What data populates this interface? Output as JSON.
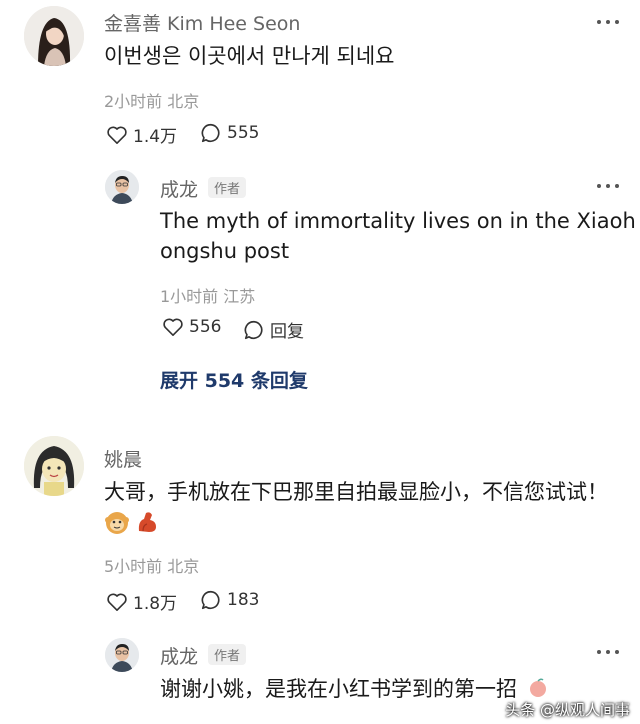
{
  "comments": [
    {
      "author": "金喜善 Kim Hee Seon",
      "text": "이번생은 이곳에서 만나게 되네요",
      "meta": "2小时前 北京",
      "likes": "1.4万",
      "replies": "555",
      "avatar_icon": "woman-portrait-avatar"
    },
    {
      "author": "姚晨",
      "text": "大哥，手机放在下巴那里自拍最显脸小，不信您试试！",
      "meta": "5小时前 北京",
      "likes": "1.8万",
      "replies": "183",
      "avatar_icon": "cartoon-girl-avatar"
    }
  ],
  "replies": [
    {
      "author": "成龙",
      "badge": "作者",
      "text_line1": "The myth of immortality lives on in the Xiaoh",
      "text_line2": "ongshu post",
      "meta": "1小时前 江苏",
      "likes": "556",
      "reply_label": "回复"
    },
    {
      "author": "成龙",
      "badge": "作者",
      "text": "谢谢小姚，是我在小红书学到的第一招"
    }
  ],
  "expand_label": "展开 554 条回复",
  "watermark": "头条 @纵观人间事",
  "icons": [
    "heart-icon",
    "comment-bubble-icon",
    "more-dots-icon",
    "monkey-emoji-icon",
    "flexed-arm-emoji-icon"
  ]
}
